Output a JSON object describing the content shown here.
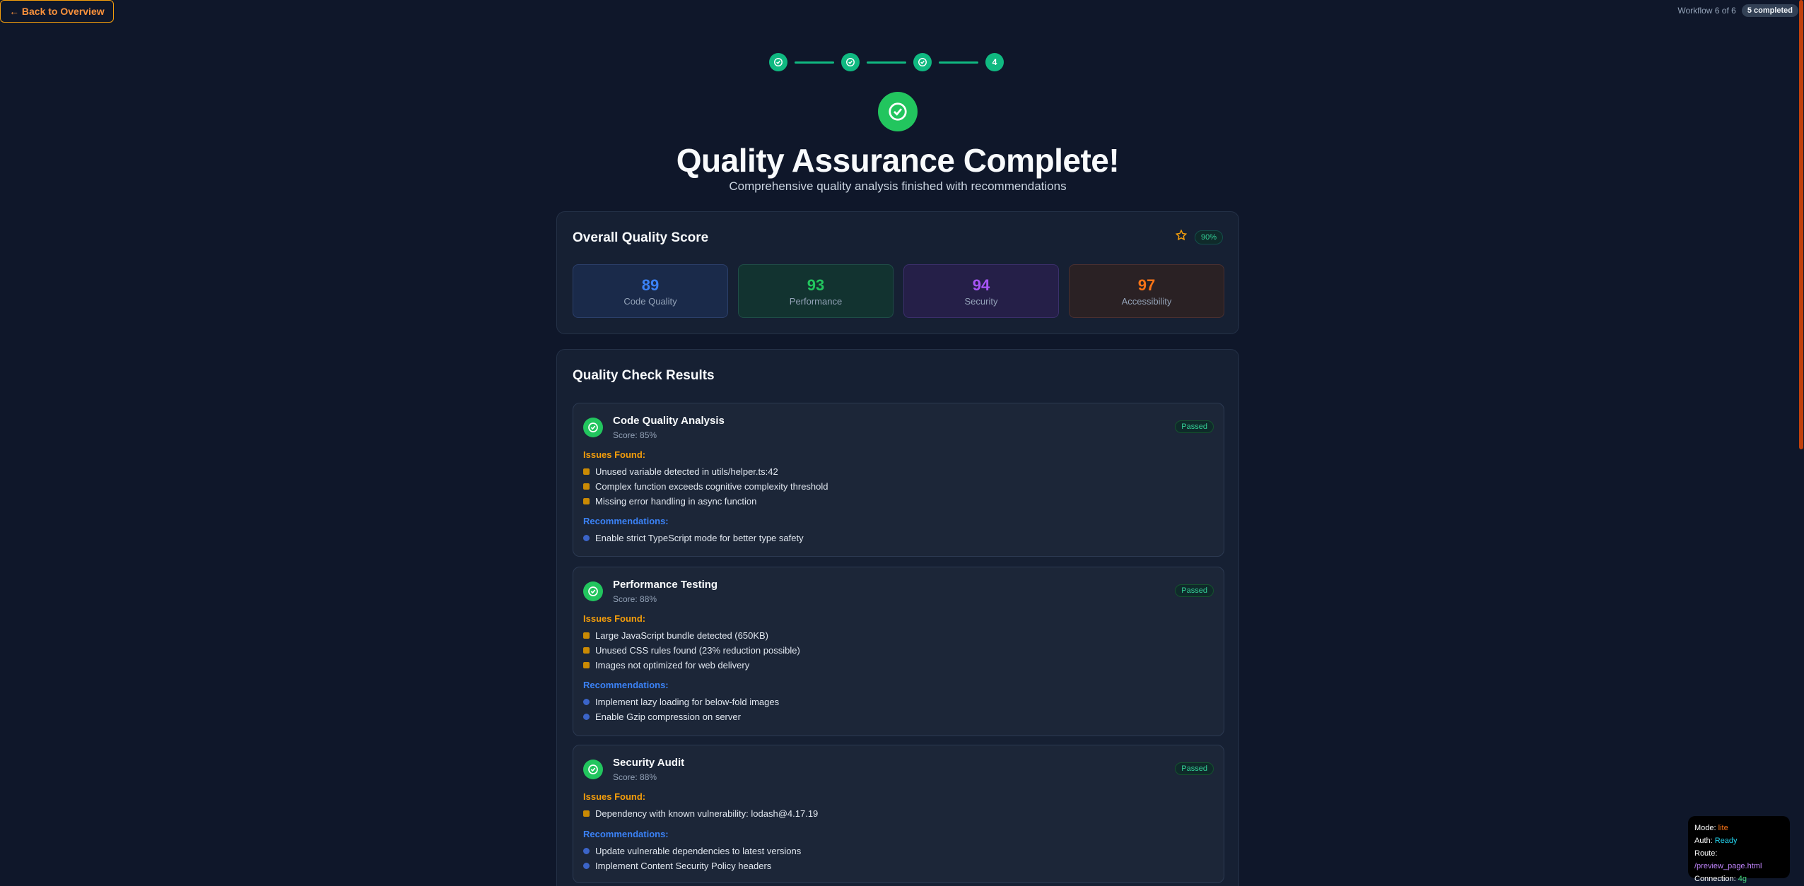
{
  "nav": {
    "back_label": "← Back to Overview"
  },
  "workflow": {
    "progress_label": "Workflow 6 of 6",
    "completed_label": "5 completed"
  },
  "stepper": {
    "current_step": "4"
  },
  "hero": {
    "title": "Quality Assurance Complete!",
    "subtitle": "Comprehensive quality analysis finished with recommendations"
  },
  "overall": {
    "title": "Overall Quality Score",
    "percent": "90%",
    "metrics": [
      {
        "value": "89",
        "label": "Code Quality",
        "color": "#3b82f6"
      },
      {
        "value": "93",
        "label": "Performance",
        "color": "#22c55e"
      },
      {
        "value": "94",
        "label": "Security",
        "color": "#a855f7"
      },
      {
        "value": "97",
        "label": "Accessibility",
        "color": "#f97316"
      }
    ]
  },
  "results": {
    "title": "Quality Check Results",
    "issues_heading": "Issues Found:",
    "recs_heading": "Recommendations:",
    "checks": [
      {
        "title": "Code Quality Analysis",
        "score": "Score: 85%",
        "status": "Passed",
        "issues": [
          "Unused variable detected in utils/helper.ts:42",
          "Complex function exceeds cognitive complexity threshold",
          "Missing error handling in async function"
        ],
        "recommendations": [
          "Enable strict TypeScript mode for better type safety"
        ]
      },
      {
        "title": "Performance Testing",
        "score": "Score: 88%",
        "status": "Passed",
        "issues": [
          "Large JavaScript bundle detected (650KB)",
          "Unused CSS rules found (23% reduction possible)",
          "Images not optimized for web delivery"
        ],
        "recommendations": [
          "Implement lazy loading for below-fold images",
          "Enable Gzip compression on server"
        ]
      },
      {
        "title": "Security Audit",
        "score": "Score: 88%",
        "status": "Passed",
        "issues": [
          "Dependency with known vulnerability: lodash@4.17.19"
        ],
        "recommendations": [
          "Update vulnerable dependencies to latest versions",
          "Implement Content Security Policy headers"
        ]
      }
    ]
  },
  "status_panel": {
    "mode_key": "Mode:",
    "mode_val": "lite",
    "auth_key": "Auth:",
    "auth_val": "Ready",
    "route_key": "Route:",
    "route_val": "/preview_page.html",
    "conn_key": "Connection:",
    "conn_val": "4g"
  },
  "colors": {
    "accent": "#10b981",
    "warn": "#f59e0b",
    "info": "#3b82f6",
    "bg": "#0f172a"
  }
}
